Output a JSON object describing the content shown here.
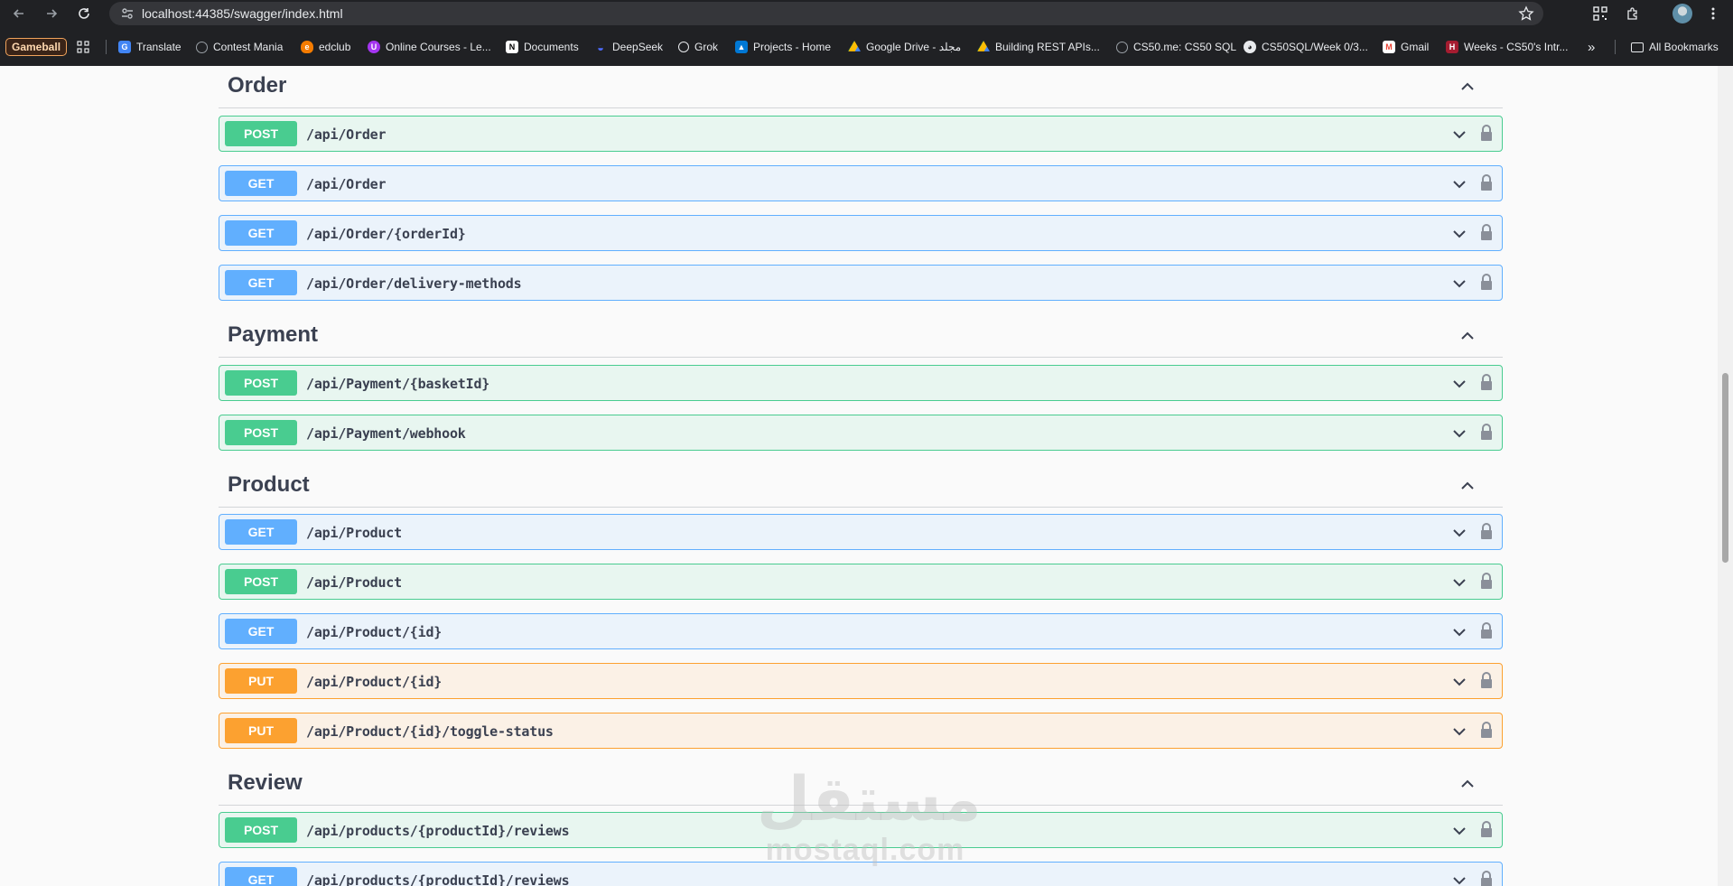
{
  "browser": {
    "url": "localhost:44385/swagger/index.html",
    "bookmarks": [
      {
        "label": "Gameball",
        "icon": "gameball-icon"
      },
      {
        "label": "Translate",
        "icon": "google-translate-icon",
        "color": "#4285f4"
      },
      {
        "label": "Contest Mania",
        "icon": "globe-icon",
        "color": "#9aa0a6"
      },
      {
        "label": "edclub",
        "icon": "edclub-icon",
        "color": "#f57c00"
      },
      {
        "label": "Online Courses - Le...",
        "icon": "udemy-icon",
        "color": "#a435f0"
      },
      {
        "label": "Documents",
        "icon": "notion-icon",
        "color": "#202124"
      },
      {
        "label": "DeepSeek",
        "icon": "deepseek-icon",
        "color": "#4d6bfe"
      },
      {
        "label": "Grok",
        "icon": "grok-icon",
        "color": "#e8eaed"
      },
      {
        "label": "Projects - Home",
        "icon": "azure-devops-icon",
        "color": "#0078d4"
      },
      {
        "label": "Google Drive - مجلد",
        "icon": "google-drive-icon",
        "color": "#fbbc04"
      },
      {
        "label": "Building REST APIs...",
        "icon": "google-drive-icon",
        "color": "#34a853"
      },
      {
        "label": "CS50.me: CS50 SQL",
        "icon": "globe-icon",
        "color": "#9aa0a6"
      },
      {
        "label": "CS50SQL/Week 0/3...",
        "icon": "github-icon",
        "color": "#e8eaed"
      },
      {
        "label": "Gmail",
        "icon": "gmail-icon",
        "color": "#ea4335"
      },
      {
        "label": "Weeks - CS50's Intr...",
        "icon": "harvard-icon",
        "color": "#a51c30"
      }
    ],
    "overflow_label": "»",
    "all_bookmarks": "All Bookmarks"
  },
  "sections": [
    {
      "title": "Order",
      "operations": [
        {
          "method": "POST",
          "path": "/api/Order"
        },
        {
          "method": "GET",
          "path": "/api/Order"
        },
        {
          "method": "GET",
          "path": "/api/Order/{orderId}"
        },
        {
          "method": "GET",
          "path": "/api/Order/delivery-methods"
        }
      ]
    },
    {
      "title": "Payment",
      "operations": [
        {
          "method": "POST",
          "path": "/api/Payment/{basketId}"
        },
        {
          "method": "POST",
          "path": "/api/Payment/webhook"
        }
      ]
    },
    {
      "title": "Product",
      "operations": [
        {
          "method": "GET",
          "path": "/api/Product"
        },
        {
          "method": "POST",
          "path": "/api/Product"
        },
        {
          "method": "GET",
          "path": "/api/Product/{id}"
        },
        {
          "method": "PUT",
          "path": "/api/Product/{id}"
        },
        {
          "method": "PUT",
          "path": "/api/Product/{id}/toggle-status"
        }
      ]
    },
    {
      "title": "Review",
      "operations": [
        {
          "method": "POST",
          "path": "/api/products/{productId}/reviews"
        },
        {
          "method": "GET",
          "path": "/api/products/{productId}/reviews"
        }
      ]
    }
  ],
  "watermark": {
    "arabic": "مستقل",
    "latin": "mostaql.com"
  },
  "colors": {
    "post": "#49cc90",
    "get": "#61affe",
    "put": "#fca130",
    "text": "#3b4151"
  }
}
